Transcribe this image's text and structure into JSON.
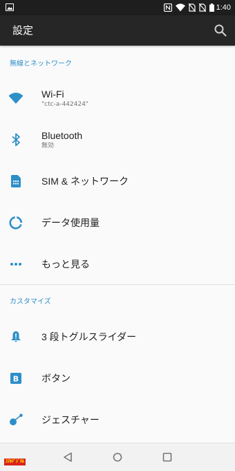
{
  "status_bar": {
    "time": "1:40",
    "icons": [
      "image-icon",
      "nfc-icon",
      "wifi-icon",
      "no-sim-icon",
      "no-sim-icon",
      "battery-icon"
    ]
  },
  "app_bar": {
    "title": "設定",
    "search_icon": "search-icon"
  },
  "sections": [
    {
      "header": "無線とネットワーク",
      "items": [
        {
          "label": "Wi-Fi",
          "sub": "\"ctc-a-442424\"",
          "icon": "wifi-icon"
        },
        {
          "label": "Bluetooth",
          "sub": "無効",
          "icon": "bluetooth-icon"
        },
        {
          "label": "SIM & ネットワーク",
          "icon": "sim-card-icon"
        },
        {
          "label": "データ使用量",
          "icon": "data-usage-icon"
        },
        {
          "label": "もっと見る",
          "icon": "more-icon"
        }
      ]
    },
    {
      "header": "カスタマイズ",
      "items": [
        {
          "label": "3 段トグルスライダー",
          "icon": "alert-slider-icon"
        },
        {
          "label": "ボタン",
          "icon": "buttons-icon"
        },
        {
          "label": "ジェスチャー",
          "icon": "gesture-icon"
        }
      ]
    }
  ],
  "navigation": {
    "back": "back-icon",
    "home": "home-icon",
    "recents": "recents-icon"
  },
  "watermark": {
    "text": "ｽﾏﾎﾃﾞｼﾞﾀﾙ"
  },
  "colors": {
    "accent": "#2d8fc8",
    "app_bar": "#262626",
    "status_bar": "#1e1e1e",
    "background": "#fafafa"
  }
}
